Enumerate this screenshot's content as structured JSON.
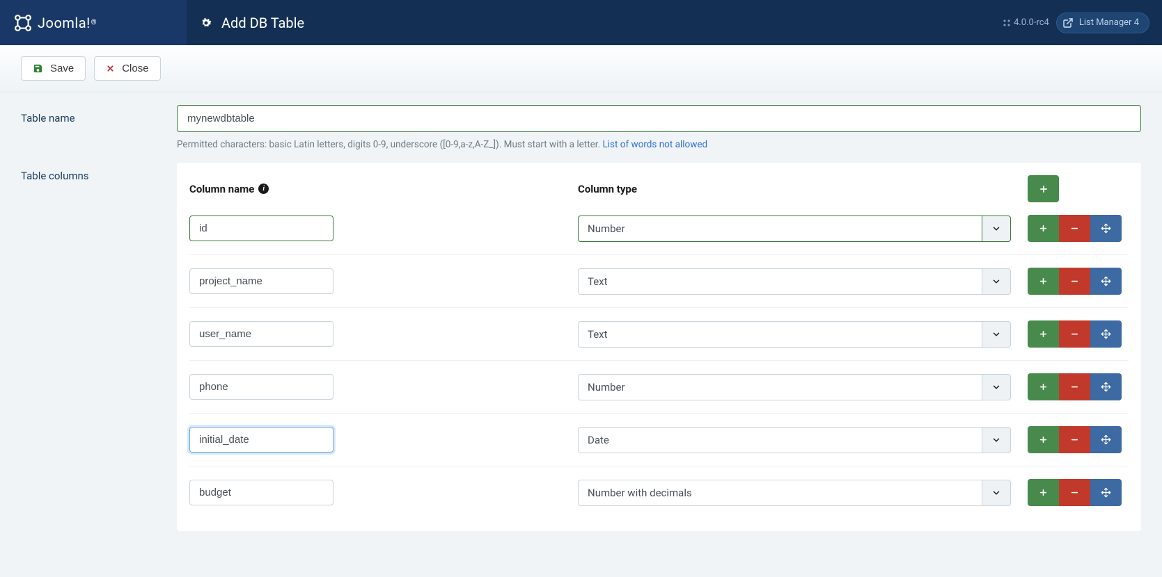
{
  "header": {
    "brand": "Joomla!",
    "title": "Add DB Table",
    "version": "4.0.0-rc4",
    "extension": "List Manager 4"
  },
  "toolbar": {
    "save_label": "Save",
    "close_label": "Close"
  },
  "form": {
    "table_name_label": "Table name",
    "table_name_value": "mynewdbtable",
    "help_static": "Permitted characters: basic Latin letters, digits 0-9, underscore ([0-9,a-z,A-Z_]). Must start with a letter. ",
    "help_link": "List of words not allowed",
    "columns_label": "Table columns",
    "col_name_header": "Column name",
    "col_type_header": "Column type",
    "type_options": [
      "Number",
      "Text",
      "Date",
      "Number with decimals"
    ],
    "columns": [
      {
        "name": "id",
        "type": "Number",
        "green": true,
        "focused": false
      },
      {
        "name": "project_name",
        "type": "Text",
        "green": false,
        "focused": false
      },
      {
        "name": "user_name",
        "type": "Text",
        "green": false,
        "focused": false
      },
      {
        "name": "phone",
        "type": "Number",
        "green": false,
        "focused": false
      },
      {
        "name": "initial_date",
        "type": "Date",
        "green": false,
        "focused": true
      },
      {
        "name": "budget",
        "type": "Number with decimals",
        "green": false,
        "focused": false
      }
    ]
  }
}
